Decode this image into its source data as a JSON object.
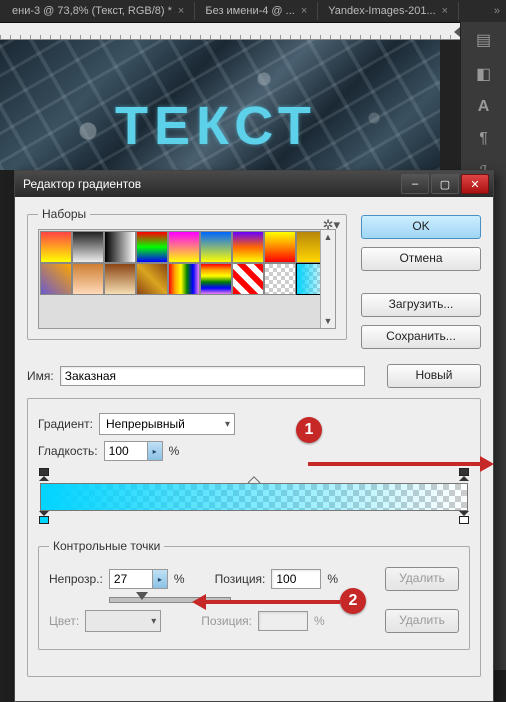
{
  "tabs": [
    {
      "label": "ени-3 @ 73,8% (Текст, RGB/8) *"
    },
    {
      "label": "Без имени-4 @ ..."
    },
    {
      "label": "Yandex-Images-201..."
    }
  ],
  "canvas_text": "ТЕКСТ",
  "dialog": {
    "title": "Редактор градиентов",
    "presets_label": "Наборы",
    "buttons": {
      "ok": "OK",
      "cancel": "Отмена",
      "load": "Загрузить...",
      "save": "Сохранить..."
    },
    "name_label": "Имя:",
    "name_value": "Заказная",
    "new_button": "Новый",
    "gradient_label": "Градиент:",
    "gradient_type": "Непрерывный",
    "smoothness_label": "Гладкость:",
    "smoothness_value": "100",
    "percent": "%",
    "control_points_label": "Контрольные точки",
    "opacity_label": "Непрозр.:",
    "opacity_value": "27",
    "position_label": "Позиция:",
    "position_value": "100",
    "color_label": "Цвет:",
    "position2_label": "Позиция:",
    "delete_label": "Удалить"
  },
  "window_controls": {
    "min": "–",
    "max": "▢",
    "close": "✕"
  },
  "annotations": {
    "one": "1",
    "two": "2"
  }
}
